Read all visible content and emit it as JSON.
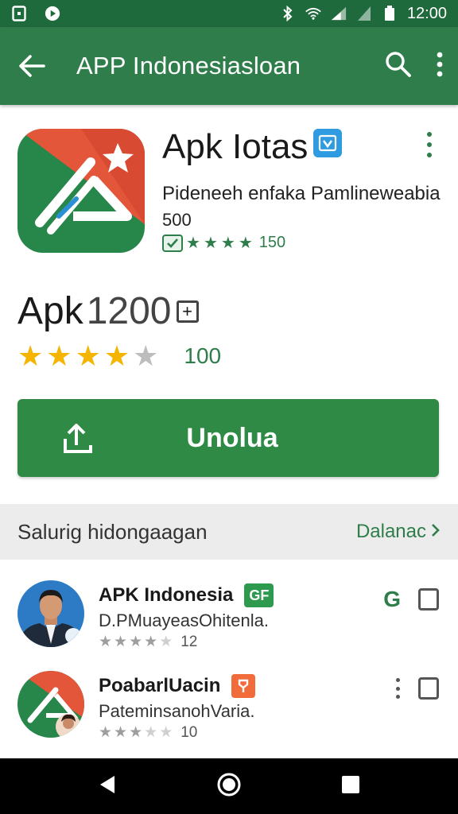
{
  "status_bar": {
    "time": "12:00"
  },
  "app_bar": {
    "title": "APP Indonesiasloan"
  },
  "app": {
    "name": "Apk Iotas",
    "developer": "Pideneeh enfaka Pamlineweabia",
    "sub_value": "500",
    "mini_rating_count": "150"
  },
  "listing": {
    "title": "Apk ",
    "version": "1200",
    "rating_stars": 4,
    "rating_count": "100",
    "download_label": "Unolua"
  },
  "section": {
    "title": "Salurig hidongaagan",
    "link": "Dalanac"
  },
  "related": [
    {
      "name": "APK Indonesia",
      "tag": "GF",
      "tag_color": "#2e9a4e",
      "subtitle": "D.PMuayeasOhitenla.",
      "rating": 4,
      "count": "12",
      "right_label": "G"
    },
    {
      "name": "PoabarlUacin",
      "tag": "",
      "tag_color": "#f26b3a",
      "subtitle": "PateminsanohVaria.",
      "rating": 3,
      "count": "10",
      "right_label": ""
    }
  ],
  "colors": {
    "primary": "#2e7d4a",
    "status_bar": "#1f6a3c",
    "star": "#f4b400",
    "button": "#2e8a45"
  }
}
